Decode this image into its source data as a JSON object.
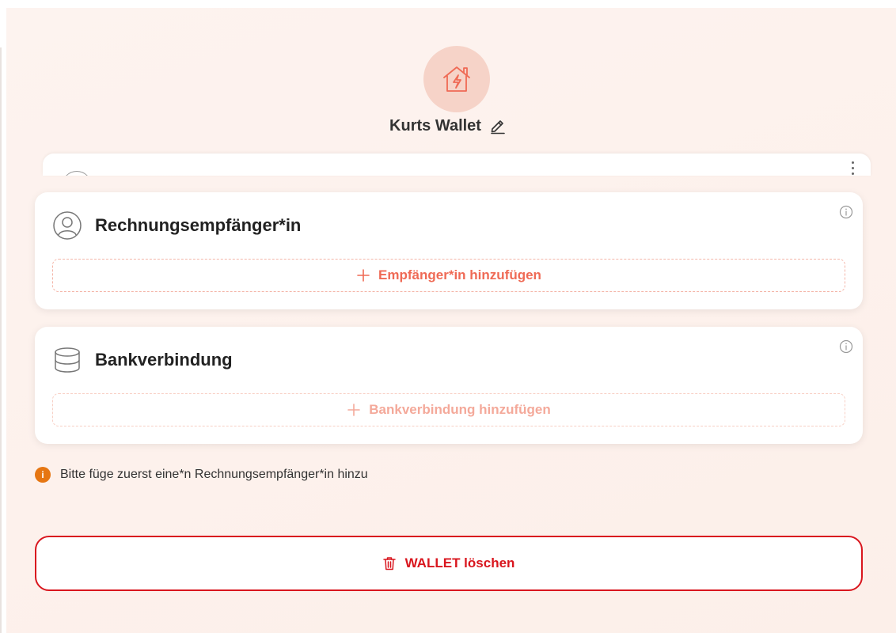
{
  "wallet": {
    "title": "Kurts Wallet",
    "avatar_icon": "house-lightning-icon",
    "edit_icon": "pencil-icon"
  },
  "recipient_card": {
    "title": "Rechnungsempfänger*in",
    "icon": "user-circle-icon",
    "add_label": "Empfänger*in hinzufügen"
  },
  "bank_card": {
    "title": "Bankverbindung",
    "icon": "database-icon",
    "add_label": "Bankverbindung hinzufügen"
  },
  "hint": {
    "icon_glyph": "i",
    "text": "Bitte füge zuerst eine*n Rechnungsempfänger*in hinzu"
  },
  "delete_button": {
    "label": "WALLET löschen",
    "icon": "trash-icon"
  },
  "colors": {
    "accent": "#ef6a55",
    "danger": "#d9161e",
    "warning": "#e67612",
    "background": "#fdf3ef"
  }
}
